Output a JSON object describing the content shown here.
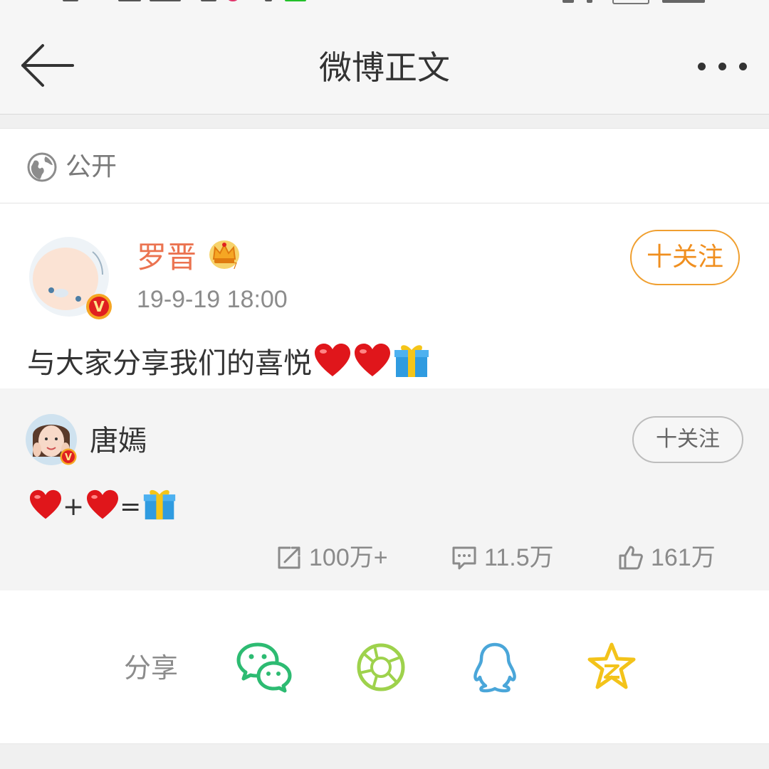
{
  "header": {
    "title": "微博正文",
    "back_icon": "arrow-left-icon",
    "more_icon": "more-dots-icon"
  },
  "visibility": {
    "icon": "globe-icon",
    "label": "公开"
  },
  "post": {
    "author": "罗晋",
    "author_color": "#eb7350",
    "verified_badge": "V",
    "member_icon": "crown-icon",
    "time": "19-9-19 18:00",
    "follow_label": "十关注",
    "text": "与大家分享我们的喜悦",
    "emojis": [
      "heart-emoji",
      "heart-emoji",
      "gift-emoji"
    ]
  },
  "repost": {
    "author": "唐嫣",
    "verified_badge": "V",
    "follow_label": "十关注",
    "text_plus": "+",
    "text_equals": "=",
    "emojis": [
      "heart-emoji",
      "heart-emoji",
      "gift-emoji"
    ],
    "actions": {
      "reposts": "100万+",
      "comments": "11.5万",
      "likes": "161万"
    }
  },
  "share": {
    "label": "分享",
    "targets": [
      "wechat-icon",
      "moments-icon",
      "qq-icon",
      "qzone-icon"
    ]
  },
  "colors": {
    "accent_orange": "#f09f2f",
    "name_orange": "#eb7350",
    "wechat_green": "#2dbb72",
    "moments_green": "#9ed24c",
    "qq_blue": "#4aa6d9",
    "qzone_yellow": "#f3c31a"
  }
}
